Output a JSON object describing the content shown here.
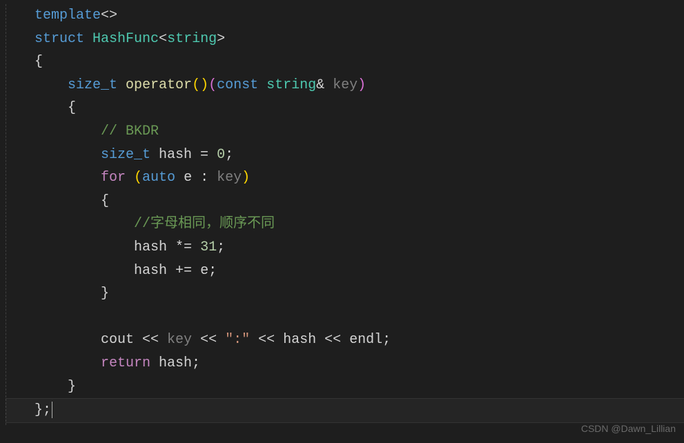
{
  "code": {
    "line1": {
      "template": "template",
      "angles": "<>"
    },
    "line2": {
      "struct": "struct",
      "name": " HashFunc",
      "open": "<",
      "string": "string",
      "close": ">"
    },
    "line3": "{",
    "line4": {
      "sizet": "size_t",
      "operator": " operator",
      "parens1": "()",
      "paren_open": "(",
      "const": "const",
      "string": " string",
      "amp": "& ",
      "key": "key",
      "paren_close": ")"
    },
    "line5": "    {",
    "line6": "        // BKDR",
    "line7": {
      "indent": "        ",
      "sizet": "size_t",
      "hash": " hash ",
      "eq": "= ",
      "zero": "0",
      "semi": ";"
    },
    "line8": {
      "indent": "        ",
      "for": "for",
      "paren_open": " (",
      "auto": "auto",
      "e": " e ",
      "colon": ": ",
      "key": "key",
      "paren_close": ")"
    },
    "line9": "        {",
    "line10": "            //字母相同，顺序不同",
    "line11": {
      "indent": "            ",
      "hash": "hash ",
      "op": "*= ",
      "num": "31",
      "semi": ";"
    },
    "line12": {
      "indent": "            ",
      "hash": "hash ",
      "op": "+= ",
      "e": "e",
      "semi": ";"
    },
    "line13": "        }",
    "line14": "",
    "line15": {
      "indent": "        ",
      "cout": "cout ",
      "op1": "<< ",
      "key": "key ",
      "op2": "<< ",
      "str": "\":\"",
      "op3": " << ",
      "hash": "hash ",
      "op4": "<< ",
      "endl": "endl",
      "semi": ";"
    },
    "line16": {
      "indent": "        ",
      "return": "return",
      "hash": " hash",
      "semi": ";"
    },
    "line17": "    }",
    "line18": "};"
  },
  "watermark": "CSDN @Dawn_Lillian"
}
